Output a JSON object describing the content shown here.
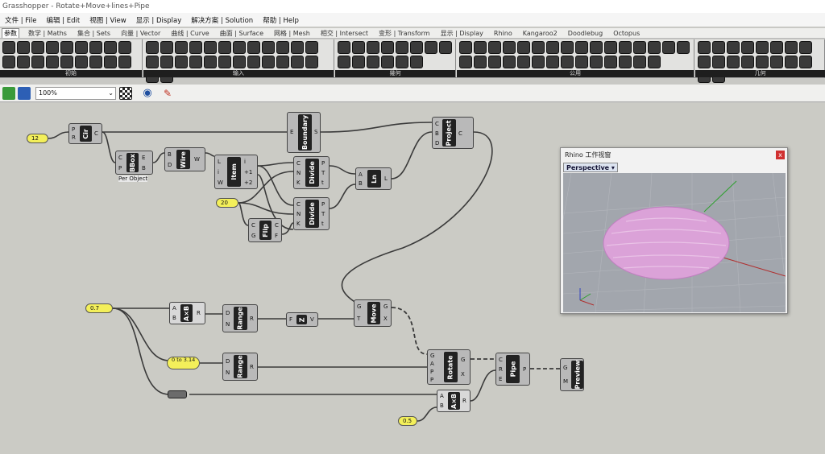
{
  "window": {
    "title": "Grasshopper - Rotate+Move+lines+Pipe"
  },
  "menu": [
    "文件 | File",
    "编辑 | Edit",
    "视图 | View",
    "显示 | Display",
    "解决方案 | Solution",
    "帮助 | Help"
  ],
  "tabs": [
    "参数",
    "数学 | Maths",
    "集合 | Sets",
    "向量 | Vector",
    "曲线 | Curve",
    "曲面 | Surface",
    "网格 | Mesh",
    "相交 | Intersect",
    "变形 | Transform",
    "显示 | Display",
    "Rhino",
    "Kangaroo2",
    "Doodlebug",
    "Octopus"
  ],
  "ribbon_panels": [
    "初始",
    "输入",
    "幾何",
    "公用",
    "几何"
  ],
  "toolbar": {
    "zoom": "100%"
  },
  "components": {
    "cir": "Cir",
    "bbox": "BBox",
    "bbox_sub": "Per Object",
    "wire": "Wire",
    "item": "Item",
    "boundary": "Boundary",
    "divide1": "Divide",
    "divide2": "Divide",
    "ln": "Ln",
    "flip": "Flip",
    "project": "Project",
    "axb1": "A×B",
    "range1": "Range",
    "z": "Z",
    "move": "Move",
    "range2": "Range",
    "rotate": "Rotate",
    "pipe": "Pipe",
    "preview": "Preview",
    "axb2": "A×B"
  },
  "sliders": {
    "s12": "12",
    "s20": "20",
    "s07": "0.7",
    "s0to": "0 to 3.14",
    "s05": "0.5"
  },
  "viewport": {
    "title": "Rhino 工作视窗",
    "view": "Perspective",
    "close": "x"
  }
}
